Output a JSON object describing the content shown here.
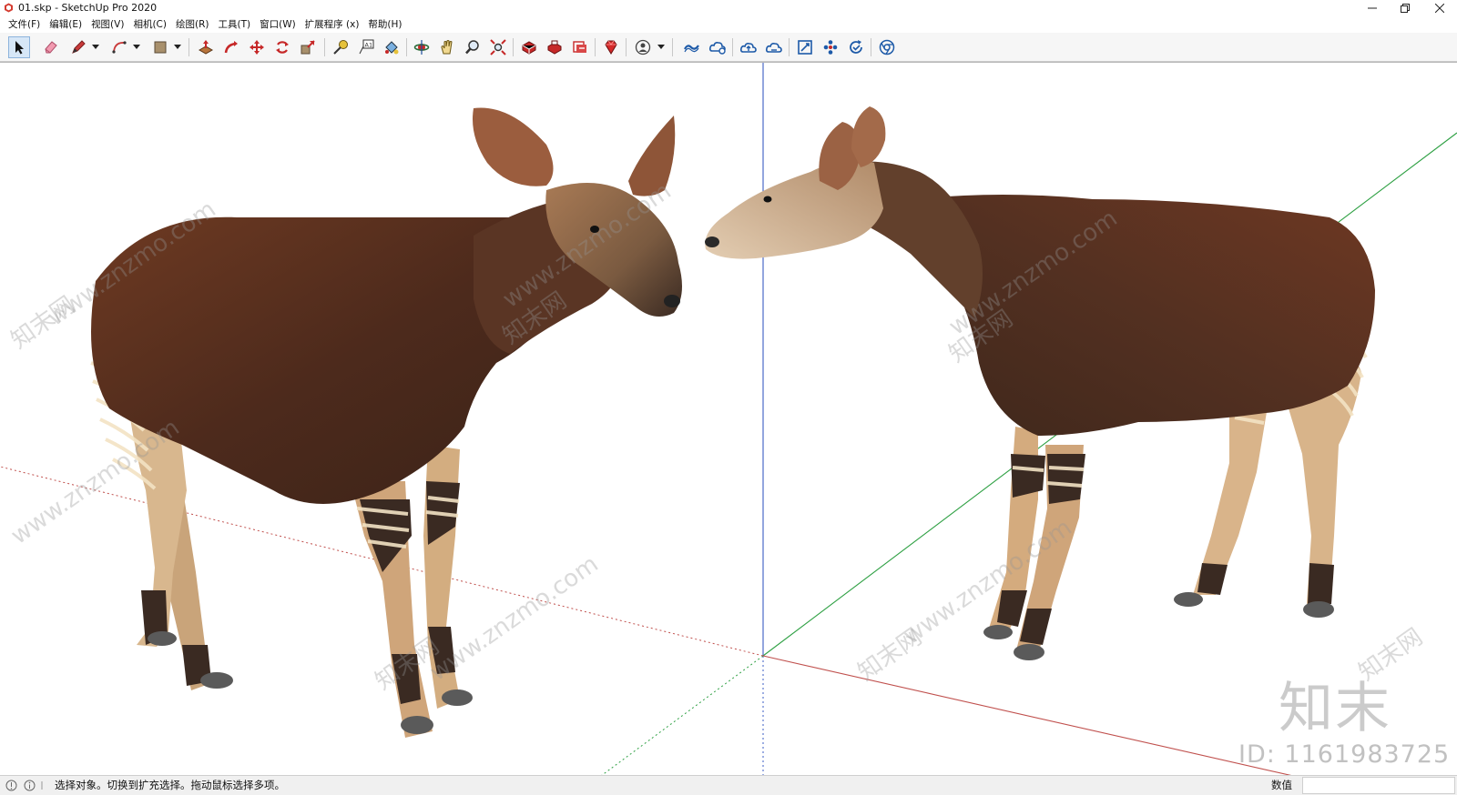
{
  "window": {
    "title": "01.skp - SketchUp Pro 2020",
    "app_icon": "sketchup-logo-icon",
    "controls": [
      "minimize-icon",
      "restore-icon",
      "close-icon"
    ]
  },
  "menu": [
    {
      "label": "文件(F)"
    },
    {
      "label": "编辑(E)"
    },
    {
      "label": "视图(V)"
    },
    {
      "label": "相机(C)"
    },
    {
      "label": "绘图(R)"
    },
    {
      "label": "工具(T)"
    },
    {
      "label": "窗口(W)"
    },
    {
      "label": "扩展程序 (x)"
    },
    {
      "label": "帮助(H)"
    }
  ],
  "toolbar": {
    "tools": [
      {
        "icon": "select-arrow-icon",
        "active": true
      },
      {
        "icon": "eraser-icon"
      },
      {
        "icon": "line-pencil-icon",
        "dropdown": true
      },
      {
        "icon": "arc-icon",
        "dropdown": true
      },
      {
        "icon": "rectangle-shape-icon",
        "dropdown": true
      },
      {
        "icon": "push-pull-icon"
      },
      {
        "icon": "follow-me-icon"
      },
      {
        "icon": "move-icon"
      },
      {
        "icon": "rotate-icon"
      },
      {
        "icon": "scale-icon"
      },
      {
        "icon": "tape-measure-icon"
      },
      {
        "icon": "text-label-icon"
      },
      {
        "icon": "paint-bucket-icon"
      },
      {
        "icon": "orbit-icon"
      },
      {
        "icon": "pan-hand-icon"
      },
      {
        "icon": "zoom-icon"
      },
      {
        "icon": "zoom-extents-icon"
      },
      {
        "icon": "3d-warehouse-icon"
      },
      {
        "icon": "extension-warehouse-icon"
      },
      {
        "icon": "layout-send-icon"
      },
      {
        "icon": "ruby-extension-icon"
      },
      {
        "icon": "account-profile-icon",
        "dropdown": true
      },
      {
        "icon": "trimble-connect-icon"
      },
      {
        "icon": "trimble-connect-share-icon"
      },
      {
        "icon": "cloud-upload-icon"
      },
      {
        "icon": "cloud-sync-icon"
      },
      {
        "icon": "section-plane-icon"
      },
      {
        "icon": "components-icon"
      },
      {
        "icon": "update-check-icon"
      },
      {
        "icon": "chrome-browser-icon"
      }
    ]
  },
  "viewport": {
    "watermark_site": "www.znzmo.com",
    "watermark_brand": "知末网",
    "brand_mark": "知末",
    "id_label": "ID: 1161983725",
    "axis_colors": {
      "red": "#c0504d",
      "green": "#2ea043",
      "blue": "#3b5cc4"
    },
    "models": [
      "okapi-left",
      "okapi-right"
    ]
  },
  "status": {
    "icons": [
      "geolocation-icon",
      "info-icon",
      "user-instructor-icon"
    ],
    "message": "选择对象。切换到扩充选择。拖动鼠标选择多项。",
    "measure_label": "数值",
    "measure_value": ""
  }
}
